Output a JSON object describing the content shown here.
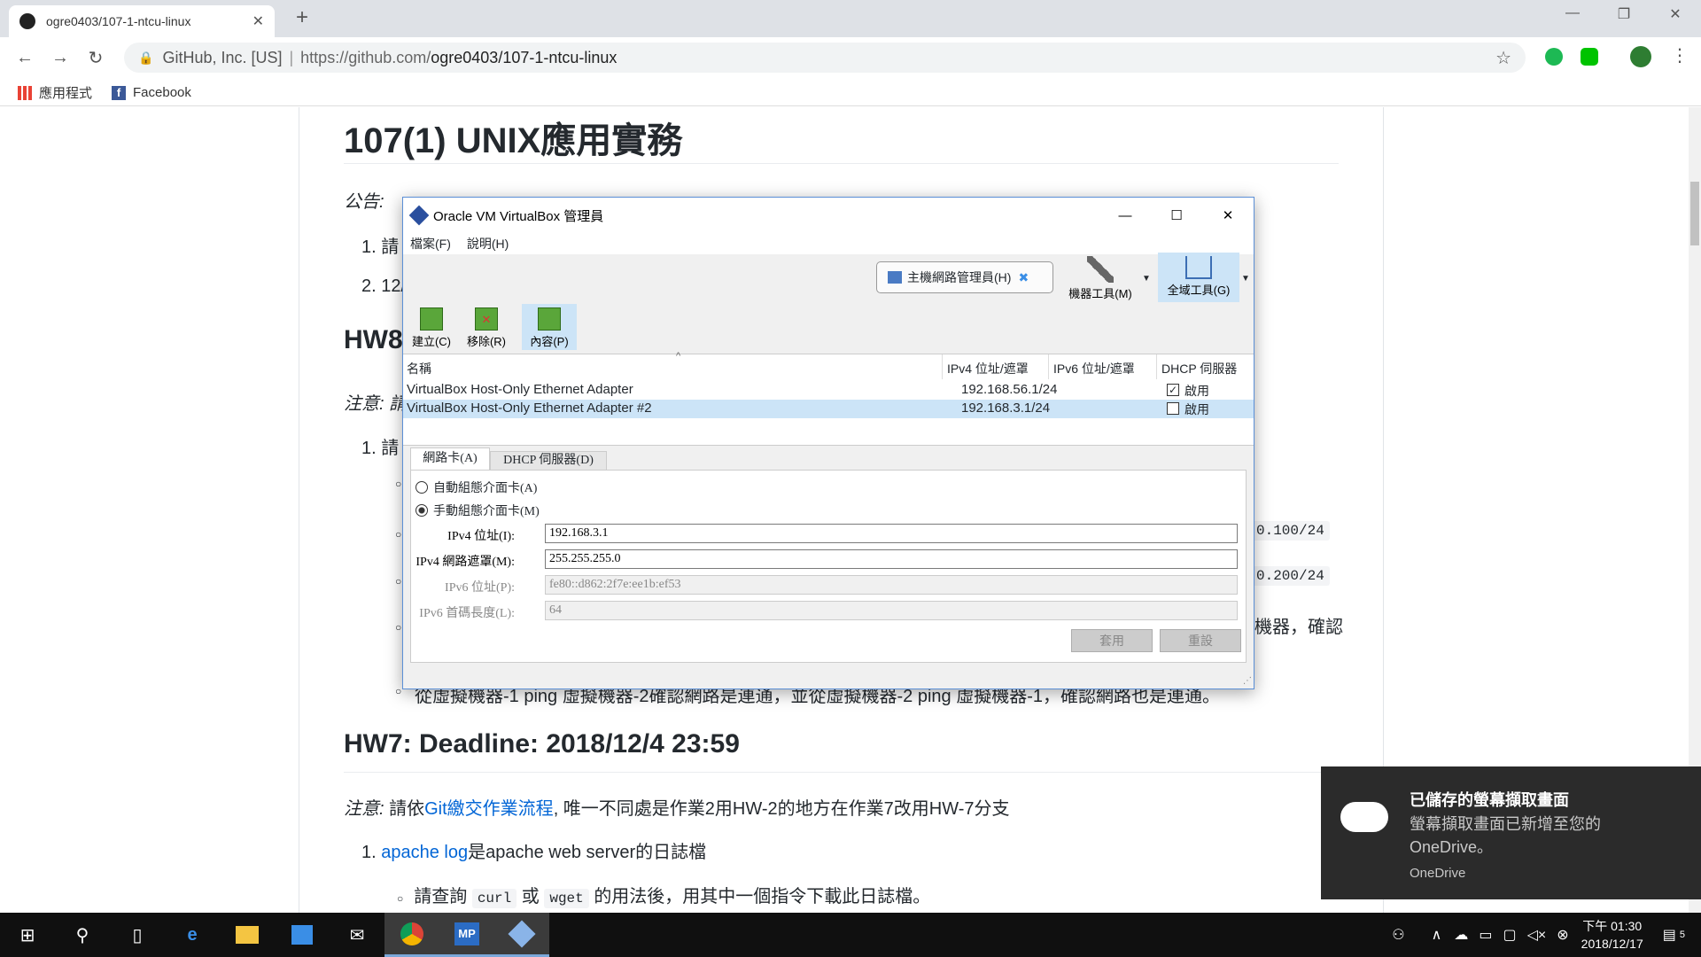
{
  "browser": {
    "tab_title": "ogre0403/107-1-ntcu-linux",
    "tab_close": "✕",
    "new_tab": "+",
    "address_secure_label": "GitHub, Inc. [US]",
    "address_url_prefix": "https://github.com/",
    "address_url_path": "ogre0403/107-1-ntcu-linux",
    "bookmarks": [
      "應用程式",
      "Facebook"
    ]
  },
  "page": {
    "title": "107(1) UNIX應用實務",
    "announce_label": "公告:",
    "item1_prefix": "1. 請",
    "item2_prefix": "2. 12/",
    "hw8_heading": "HW8",
    "hw8_note": "注意: 請",
    "hw8_item1": "1. 請",
    "code_right1": "0.100/24",
    "code_right2": "0.200/24",
    "right_text": "機器，確認",
    "cutoff_line": "從虛擬機器-1 ping 虛擬機器-2確認網路是連通，並從虛擬機器-2 ping 虛擬機器-1，確認網路也是連通。",
    "hw7_heading": "HW7: Deadline: 2018/12/4 23:59",
    "hw7_note_label": "注意:",
    "hw7_note_pre": " 請依",
    "hw7_note_link": "Git繳交作業流程",
    "hw7_note_post": ", 唯一不同處是作業2用HW-2的地方在作業7改用HW-7分支",
    "hw7_item1_num": "1.",
    "hw7_item1_link": "apache log",
    "hw7_item1_post": "是apache web server的日誌檔",
    "hw7_sub_pre": "請查詢",
    "hw7_sub_code1": "curl",
    "hw7_sub_mid": "或",
    "hw7_sub_code2": "wget",
    "hw7_sub_post": "的用法後，用其中一個指令下載此日誌檔。"
  },
  "vbox": {
    "title": "Oracle VM VirtualBox 管理員",
    "menu": [
      "檔案(F)",
      "說明(H)"
    ],
    "host_net_btn": "主機網路管理員(H)",
    "machine_tools": "機器工具(M)",
    "global_tools": "全域工具(G)",
    "create": "建立(C)",
    "remove": "移除(R)",
    "properties": "內容(P)",
    "columns": [
      "名稱",
      "IPv4 位址/遮罩",
      "IPv6 位址/遮罩",
      "DHCP 伺服器"
    ],
    "rows": [
      {
        "name": "VirtualBox Host-Only Ethernet Adapter",
        "ipv4": "192.168.56.1/24",
        "ipv6": "",
        "dhcp": "啟用",
        "dhcp_checked": true
      },
      {
        "name": "VirtualBox Host-Only Ethernet Adapter #2",
        "ipv4": "192.168.3.1/24",
        "ipv6": "",
        "dhcp": "啟用",
        "dhcp_checked": false
      }
    ],
    "tabs": [
      "網路卡(A)",
      "DHCP 伺服器(D)"
    ],
    "radio_auto": "自動組態介面卡(A)",
    "radio_manual": "手動組態介面卡(M)",
    "ipv4_addr_label": "IPv4 位址(I):",
    "ipv4_addr": "192.168.3.1",
    "ipv4_mask_label": "IPv4 網路遮罩(M):",
    "ipv4_mask": "255.255.255.0",
    "ipv6_addr_label": "IPv6 位址(P):",
    "ipv6_addr": "fe80::d862:2f7e:ee1b:ef53",
    "ipv6_prefix_label": "IPv6 首碼長度(L):",
    "ipv6_prefix": "64",
    "apply": "套用",
    "reset": "重設"
  },
  "toast": {
    "title": "已儲存的螢幕擷取畫面",
    "body": "螢幕擷取畫面已新增至您的 OneDrive。",
    "source": "OneDrive"
  },
  "taskbar": {
    "time_ampm": "下午 01:30",
    "date": "2018/12/17",
    "notif_count": "5",
    "mp_label": "MP"
  },
  "colors": {
    "accent": "#0366d6",
    "vbox_select": "#cce4f7",
    "toast_bg": "#2b2b2b"
  }
}
